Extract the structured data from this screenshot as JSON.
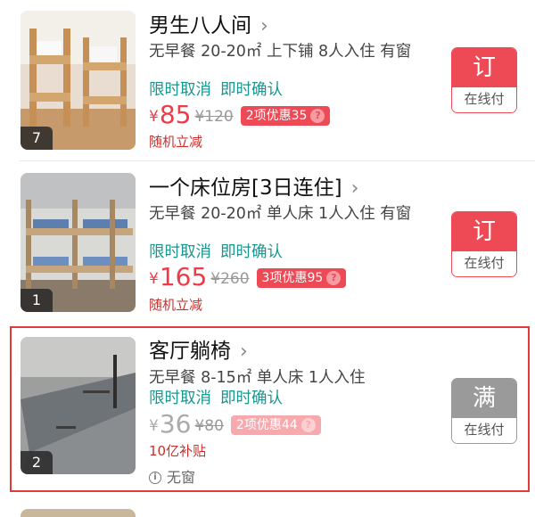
{
  "rooms": [
    {
      "name": "男生八人间",
      "desc": "无早餐 20-20㎡ 上下铺 8人入住 有窗",
      "policies": [
        "限时取消",
        "即时确认"
      ],
      "currency": "¥",
      "price": "85",
      "original_price": "¥120",
      "promo": "2项优惠35",
      "note": "随机立减",
      "photo_count": "7",
      "book_label": "订",
      "pay_label": "在线付"
    },
    {
      "name": "一个床位房[3日连住]",
      "desc": "无早餐 20-20㎡ 单人床 1人入住 有窗",
      "policies": [
        "限时取消",
        "即时确认"
      ],
      "currency": "¥",
      "price": "165",
      "original_price": "¥260",
      "promo": "3项优惠95",
      "note": "随机立减",
      "photo_count": "1",
      "book_label": "订",
      "pay_label": "在线付"
    },
    {
      "name": "客厅躺椅",
      "desc": "无早餐 8-15㎡ 单人床 1人入住",
      "policies": [
        "限时取消",
        "即时确认"
      ],
      "currency": "¥",
      "price": "36",
      "original_price": "¥80",
      "promo": "2项优惠44",
      "note": "10亿补贴",
      "window_info": "无窗",
      "photo_count": "2",
      "book_label": "满",
      "pay_label": "在线付"
    }
  ],
  "chevron": "›",
  "help_glyph": "?",
  "info_glyph": "i",
  "colors": {
    "price_red": "#ee3b48",
    "policy_teal": "#17958f",
    "book_red": "#ee4a55",
    "sold_out_grey": "#9a9a9a",
    "highlight_border": "#e23a3a"
  }
}
